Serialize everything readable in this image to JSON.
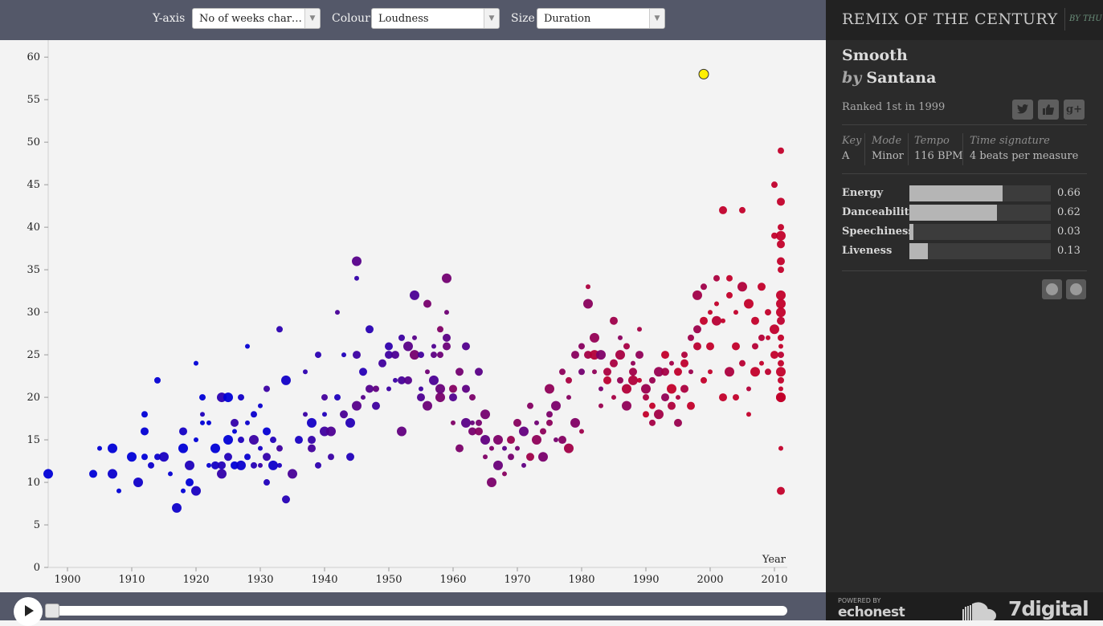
{
  "toolbar": {
    "yaxis_label": "Y-axis",
    "yaxis_value": "No of weeks char…",
    "colour_label": "Colour",
    "colour_value": "Loudness",
    "size_label": "Size",
    "size_value": "Duration"
  },
  "chart_data": {
    "type": "scatter",
    "xlabel": "Year",
    "ylabel": "",
    "xlim": [
      1897,
      2012
    ],
    "ylim": [
      0,
      62
    ],
    "xticks": [
      1900,
      1910,
      1920,
      1930,
      1940,
      1950,
      1960,
      1970,
      1980,
      1990,
      2000,
      2010
    ],
    "yticks": [
      0,
      5,
      10,
      15,
      20,
      25,
      30,
      35,
      40,
      45,
      50,
      55,
      60
    ],
    "colour_low": "#0000d6",
    "colour_high": "#c2002a",
    "highlight_colour": "#ffef00",
    "points": [
      {
        "x": 1897,
        "y": 11
      },
      {
        "x": 1904,
        "y": 11
      },
      {
        "x": 1905,
        "y": 14
      },
      {
        "x": 1907,
        "y": 14
      },
      {
        "x": 1907,
        "y": 11
      },
      {
        "x": 1908,
        "y": 9
      },
      {
        "x": 1910,
        "y": 13
      },
      {
        "x": 1911,
        "y": 10
      },
      {
        "x": 1912,
        "y": 13
      },
      {
        "x": 1912,
        "y": 18
      },
      {
        "x": 1912,
        "y": 16
      },
      {
        "x": 1913,
        "y": 12
      },
      {
        "x": 1914,
        "y": 13
      },
      {
        "x": 1914,
        "y": 22
      },
      {
        "x": 1915,
        "y": 13
      },
      {
        "x": 1916,
        "y": 11
      },
      {
        "x": 1917,
        "y": 7
      },
      {
        "x": 1918,
        "y": 9
      },
      {
        "x": 1918,
        "y": 16
      },
      {
        "x": 1918,
        "y": 14
      },
      {
        "x": 1919,
        "y": 10
      },
      {
        "x": 1919,
        "y": 12
      },
      {
        "x": 1920,
        "y": 9
      },
      {
        "x": 1920,
        "y": 15
      },
      {
        "x": 1920,
        "y": 24
      },
      {
        "x": 1921,
        "y": 17
      },
      {
        "x": 1921,
        "y": 18
      },
      {
        "x": 1921,
        "y": 20
      },
      {
        "x": 1922,
        "y": 12
      },
      {
        "x": 1922,
        "y": 17
      },
      {
        "x": 1923,
        "y": 12
      },
      {
        "x": 1923,
        "y": 14
      },
      {
        "x": 1924,
        "y": 11
      },
      {
        "x": 1924,
        "y": 20
      },
      {
        "x": 1924,
        "y": 12
      },
      {
        "x": 1925,
        "y": 13
      },
      {
        "x": 1925,
        "y": 15
      },
      {
        "x": 1925,
        "y": 20
      },
      {
        "x": 1926,
        "y": 12
      },
      {
        "x": 1926,
        "y": 17
      },
      {
        "x": 1926,
        "y": 16
      },
      {
        "x": 1927,
        "y": 12
      },
      {
        "x": 1927,
        "y": 15
      },
      {
        "x": 1927,
        "y": 20
      },
      {
        "x": 1928,
        "y": 13
      },
      {
        "x": 1928,
        "y": 17
      },
      {
        "x": 1928,
        "y": 26
      },
      {
        "x": 1929,
        "y": 12
      },
      {
        "x": 1929,
        "y": 15
      },
      {
        "x": 1929,
        "y": 18
      },
      {
        "x": 1930,
        "y": 14
      },
      {
        "x": 1930,
        "y": 19
      },
      {
        "x": 1930,
        "y": 12
      },
      {
        "x": 1931,
        "y": 10
      },
      {
        "x": 1931,
        "y": 16
      },
      {
        "x": 1931,
        "y": 13
      },
      {
        "x": 1931,
        "y": 21
      },
      {
        "x": 1932,
        "y": 12
      },
      {
        "x": 1932,
        "y": 15
      },
      {
        "x": 1933,
        "y": 28
      },
      {
        "x": 1933,
        "y": 12
      },
      {
        "x": 1933,
        "y": 14
      },
      {
        "x": 1934,
        "y": 8
      },
      {
        "x": 1934,
        "y": 22
      },
      {
        "x": 1935,
        "y": 11
      },
      {
        "x": 1936,
        "y": 15
      },
      {
        "x": 1937,
        "y": 18
      },
      {
        "x": 1937,
        "y": 23
      },
      {
        "x": 1938,
        "y": 14
      },
      {
        "x": 1938,
        "y": 15
      },
      {
        "x": 1938,
        "y": 17
      },
      {
        "x": 1939,
        "y": 12
      },
      {
        "x": 1939,
        "y": 25
      },
      {
        "x": 1940,
        "y": 16
      },
      {
        "x": 1940,
        "y": 18
      },
      {
        "x": 1940,
        "y": 20
      },
      {
        "x": 1941,
        "y": 13
      },
      {
        "x": 1941,
        "y": 16
      },
      {
        "x": 1942,
        "y": 30
      },
      {
        "x": 1942,
        "y": 20
      },
      {
        "x": 1943,
        "y": 18
      },
      {
        "x": 1943,
        "y": 25
      },
      {
        "x": 1944,
        "y": 17
      },
      {
        "x": 1944,
        "y": 13
      },
      {
        "x": 1945,
        "y": 19
      },
      {
        "x": 1945,
        "y": 36
      },
      {
        "x": 1945,
        "y": 34
      },
      {
        "x": 1945,
        "y": 25
      },
      {
        "x": 1946,
        "y": 20
      },
      {
        "x": 1946,
        "y": 23
      },
      {
        "x": 1947,
        "y": 28
      },
      {
        "x": 1947,
        "y": 21
      },
      {
        "x": 1948,
        "y": 21
      },
      {
        "x": 1948,
        "y": 19
      },
      {
        "x": 1949,
        "y": 24
      },
      {
        "x": 1950,
        "y": 25
      },
      {
        "x": 1950,
        "y": 26
      },
      {
        "x": 1950,
        "y": 21
      },
      {
        "x": 1951,
        "y": 22
      },
      {
        "x": 1951,
        "y": 25
      },
      {
        "x": 1952,
        "y": 22
      },
      {
        "x": 1952,
        "y": 16
      },
      {
        "x": 1952,
        "y": 27
      },
      {
        "x": 1953,
        "y": 26
      },
      {
        "x": 1953,
        "y": 22
      },
      {
        "x": 1954,
        "y": 32
      },
      {
        "x": 1954,
        "y": 25
      },
      {
        "x": 1954,
        "y": 27
      },
      {
        "x": 1955,
        "y": 25
      },
      {
        "x": 1955,
        "y": 21
      },
      {
        "x": 1955,
        "y": 20
      },
      {
        "x": 1956,
        "y": 23
      },
      {
        "x": 1956,
        "y": 19
      },
      {
        "x": 1956,
        "y": 31
      },
      {
        "x": 1957,
        "y": 26
      },
      {
        "x": 1957,
        "y": 22
      },
      {
        "x": 1957,
        "y": 25
      },
      {
        "x": 1958,
        "y": 20
      },
      {
        "x": 1958,
        "y": 21
      },
      {
        "x": 1958,
        "y": 28
      },
      {
        "x": 1958,
        "y": 25
      },
      {
        "x": 1959,
        "y": 27
      },
      {
        "x": 1959,
        "y": 30
      },
      {
        "x": 1959,
        "y": 34
      },
      {
        "x": 1959,
        "y": 26
      },
      {
        "x": 1960,
        "y": 17
      },
      {
        "x": 1960,
        "y": 20
      },
      {
        "x": 1960,
        "y": 21
      },
      {
        "x": 1961,
        "y": 14
      },
      {
        "x": 1961,
        "y": 23
      },
      {
        "x": 1962,
        "y": 17
      },
      {
        "x": 1962,
        "y": 21
      },
      {
        "x": 1962,
        "y": 26
      },
      {
        "x": 1963,
        "y": 17
      },
      {
        "x": 1963,
        "y": 16
      },
      {
        "x": 1963,
        "y": 20
      },
      {
        "x": 1964,
        "y": 17
      },
      {
        "x": 1964,
        "y": 23
      },
      {
        "x": 1964,
        "y": 16
      },
      {
        "x": 1965,
        "y": 18
      },
      {
        "x": 1965,
        "y": 15
      },
      {
        "x": 1965,
        "y": 13
      },
      {
        "x": 1966,
        "y": 14
      },
      {
        "x": 1966,
        "y": 10
      },
      {
        "x": 1967,
        "y": 15
      },
      {
        "x": 1967,
        "y": 12
      },
      {
        "x": 1968,
        "y": 14
      },
      {
        "x": 1968,
        "y": 11
      },
      {
        "x": 1969,
        "y": 13
      },
      {
        "x": 1969,
        "y": 15
      },
      {
        "x": 1970,
        "y": 14
      },
      {
        "x": 1970,
        "y": 17
      },
      {
        "x": 1971,
        "y": 12
      },
      {
        "x": 1971,
        "y": 16
      },
      {
        "x": 1972,
        "y": 19
      },
      {
        "x": 1972,
        "y": 13
      },
      {
        "x": 1973,
        "y": 15
      },
      {
        "x": 1973,
        "y": 17
      },
      {
        "x": 1974,
        "y": 13
      },
      {
        "x": 1974,
        "y": 16
      },
      {
        "x": 1975,
        "y": 17
      },
      {
        "x": 1975,
        "y": 18
      },
      {
        "x": 1975,
        "y": 21
      },
      {
        "x": 1976,
        "y": 15
      },
      {
        "x": 1976,
        "y": 19
      },
      {
        "x": 1977,
        "y": 15
      },
      {
        "x": 1977,
        "y": 23
      },
      {
        "x": 1978,
        "y": 14
      },
      {
        "x": 1978,
        "y": 20
      },
      {
        "x": 1978,
        "y": 22
      },
      {
        "x": 1979,
        "y": 17
      },
      {
        "x": 1979,
        "y": 25
      },
      {
        "x": 1980,
        "y": 16
      },
      {
        "x": 1980,
        "y": 26
      },
      {
        "x": 1980,
        "y": 23
      },
      {
        "x": 1981,
        "y": 25
      },
      {
        "x": 1981,
        "y": 31
      },
      {
        "x": 1981,
        "y": 33
      },
      {
        "x": 1982,
        "y": 25
      },
      {
        "x": 1982,
        "y": 23
      },
      {
        "x": 1982,
        "y": 27
      },
      {
        "x": 1983,
        "y": 21
      },
      {
        "x": 1983,
        "y": 25
      },
      {
        "x": 1983,
        "y": 19
      },
      {
        "x": 1984,
        "y": 22
      },
      {
        "x": 1984,
        "y": 23
      },
      {
        "x": 1985,
        "y": 24
      },
      {
        "x": 1985,
        "y": 29
      },
      {
        "x": 1985,
        "y": 20
      },
      {
        "x": 1986,
        "y": 22
      },
      {
        "x": 1986,
        "y": 25
      },
      {
        "x": 1986,
        "y": 27
      },
      {
        "x": 1987,
        "y": 19
      },
      {
        "x": 1987,
        "y": 26
      },
      {
        "x": 1987,
        "y": 21
      },
      {
        "x": 1988,
        "y": 22
      },
      {
        "x": 1988,
        "y": 24
      },
      {
        "x": 1988,
        "y": 23
      },
      {
        "x": 1989,
        "y": 22
      },
      {
        "x": 1989,
        "y": 25
      },
      {
        "x": 1989,
        "y": 28
      },
      {
        "x": 1990,
        "y": 18
      },
      {
        "x": 1990,
        "y": 21
      },
      {
        "x": 1990,
        "y": 20
      },
      {
        "x": 1991,
        "y": 17
      },
      {
        "x": 1991,
        "y": 22
      },
      {
        "x": 1991,
        "y": 19
      },
      {
        "x": 1992,
        "y": 18
      },
      {
        "x": 1992,
        "y": 23
      },
      {
        "x": 1993,
        "y": 23
      },
      {
        "x": 1993,
        "y": 20
      },
      {
        "x": 1993,
        "y": 25
      },
      {
        "x": 1994,
        "y": 24
      },
      {
        "x": 1994,
        "y": 19
      },
      {
        "x": 1994,
        "y": 21
      },
      {
        "x": 1995,
        "y": 17
      },
      {
        "x": 1995,
        "y": 20
      },
      {
        "x": 1995,
        "y": 23
      },
      {
        "x": 1996,
        "y": 24
      },
      {
        "x": 1996,
        "y": 21
      },
      {
        "x": 1996,
        "y": 25
      },
      {
        "x": 1997,
        "y": 19
      },
      {
        "x": 1997,
        "y": 27
      },
      {
        "x": 1997,
        "y": 23
      },
      {
        "x": 1998,
        "y": 26
      },
      {
        "x": 1998,
        "y": 32
      },
      {
        "x": 1998,
        "y": 28
      },
      {
        "x": 1999,
        "y": 29
      },
      {
        "x": 1999,
        "y": 33
      },
      {
        "x": 1999,
        "y": 22
      },
      {
        "x": 2000,
        "y": 30
      },
      {
        "x": 2000,
        "y": 23
      },
      {
        "x": 2000,
        "y": 26
      },
      {
        "x": 2001,
        "y": 34
      },
      {
        "x": 2001,
        "y": 29
      },
      {
        "x": 2001,
        "y": 31
      },
      {
        "x": 2002,
        "y": 42
      },
      {
        "x": 2002,
        "y": 29
      },
      {
        "x": 2002,
        "y": 20
      },
      {
        "x": 2003,
        "y": 32
      },
      {
        "x": 2003,
        "y": 23
      },
      {
        "x": 2003,
        "y": 34
      },
      {
        "x": 2004,
        "y": 30
      },
      {
        "x": 2004,
        "y": 20
      },
      {
        "x": 2004,
        "y": 26
      },
      {
        "x": 2005,
        "y": 42
      },
      {
        "x": 2005,
        "y": 33
      },
      {
        "x": 2005,
        "y": 24
      },
      {
        "x": 2006,
        "y": 31
      },
      {
        "x": 2006,
        "y": 21
      },
      {
        "x": 2006,
        "y": 18
      },
      {
        "x": 2007,
        "y": 29
      },
      {
        "x": 2007,
        "y": 23
      },
      {
        "x": 2007,
        "y": 26
      },
      {
        "x": 2008,
        "y": 27
      },
      {
        "x": 2008,
        "y": 33
      },
      {
        "x": 2008,
        "y": 24
      },
      {
        "x": 2009,
        "y": 30
      },
      {
        "x": 2009,
        "y": 23
      },
      {
        "x": 2009,
        "y": 27
      },
      {
        "x": 2010,
        "y": 45
      },
      {
        "x": 2010,
        "y": 28
      },
      {
        "x": 2010,
        "y": 39
      },
      {
        "x": 2010,
        "y": 25
      },
      {
        "x": 2011,
        "y": 49
      },
      {
        "x": 2011,
        "y": 43
      },
      {
        "x": 2011,
        "y": 36
      },
      {
        "x": 2011,
        "y": 40
      },
      {
        "x": 2011,
        "y": 31
      },
      {
        "x": 2011,
        "y": 20
      },
      {
        "x": 2011,
        "y": 14
      },
      {
        "x": 2011,
        "y": 9
      },
      {
        "x": 2011,
        "y": 38
      },
      {
        "x": 2011,
        "y": 22
      },
      {
        "x": 2011,
        "y": 26
      },
      {
        "x": 2011,
        "y": 30
      },
      {
        "x": 2011,
        "y": 23
      },
      {
        "x": 2011,
        "y": 32
      },
      {
        "x": 2011,
        "y": 35
      },
      {
        "x": 2011,
        "y": 29
      },
      {
        "x": 2011,
        "y": 25
      },
      {
        "x": 2011,
        "y": 21
      },
      {
        "x": 2011,
        "y": 27
      },
      {
        "x": 2011,
        "y": 24
      },
      {
        "x": 2011,
        "y": 39
      },
      {
        "x": 2011,
        "y": 20
      }
    ],
    "highlight": {
      "x": 1999,
      "y": 58
    }
  },
  "panel": {
    "brand": "REMIX OF THE CENTURY",
    "brand_by": "BY THU",
    "song_title": "Smooth",
    "by_word": "by",
    "artist": "Santana",
    "rank": "Ranked 1st in 1999",
    "share_icons": [
      "twitter-icon",
      "like-icon",
      "google-plus-icon"
    ],
    "meta": [
      {
        "header": "Key",
        "value": "A"
      },
      {
        "header": "Mode",
        "value": "Minor"
      },
      {
        "header": "Tempo",
        "value": "116 BPM"
      },
      {
        "header": "Time signature",
        "value": "4 beats per measure"
      }
    ],
    "features": [
      {
        "name": "Energy",
        "value": 0.66,
        "label": "0.66"
      },
      {
        "name": "Danceability",
        "value": 0.62,
        "label": "0.62"
      },
      {
        "name": "Speechiness",
        "value": 0.03,
        "label": "0.03"
      },
      {
        "name": "Liveness",
        "value": 0.13,
        "label": "0.13"
      }
    ],
    "services": [
      "spotify-icon",
      "rdio-icon"
    ]
  },
  "footer": {
    "powered_by": "POWERED BY",
    "echonest": "echonest",
    "sevendigital": "7digital"
  }
}
